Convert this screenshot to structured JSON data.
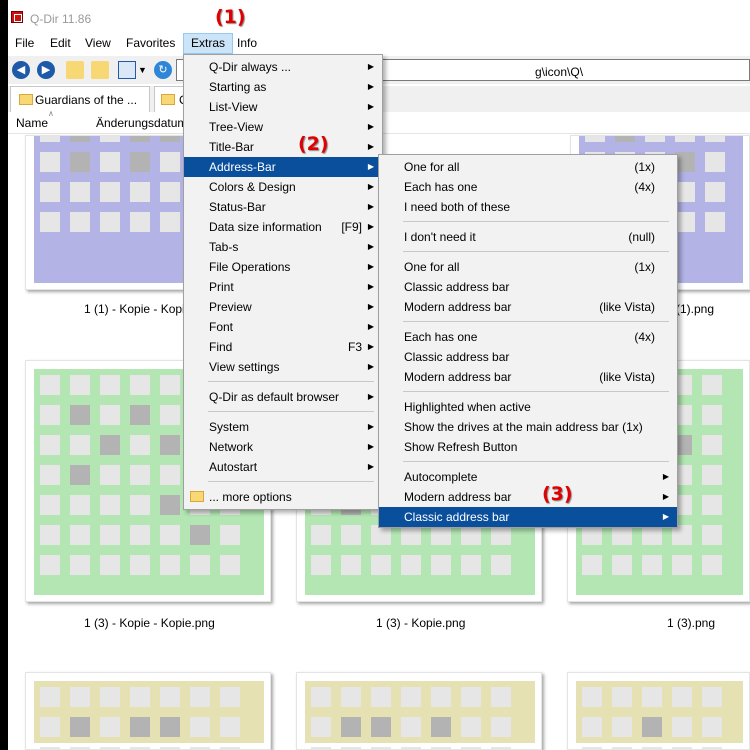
{
  "window": {
    "title": "Q-Dir 11.86"
  },
  "menubar": [
    "File",
    "Edit",
    "View",
    "Favorites",
    "Extras",
    "Info"
  ],
  "address_bar": {
    "value": "g\\icon\\Q\\"
  },
  "tabs": [
    "Guardians of the ...",
    "C"
  ],
  "columns": {
    "name": "Name",
    "date": "Änderungsdatum"
  },
  "files": {
    "row1": [
      "1 (1) - Kopie - Kopi",
      "(1).png"
    ],
    "row2": [
      "1 (3) - Kopie - Kopie.png",
      "1 (3) - Kopie.png",
      "1 (3).png"
    ]
  },
  "tile_colors": {
    "purple": "#b3b3e6",
    "green": "#b3e6b3",
    "yellow": "#e6e1b3"
  },
  "extras_menu": [
    {
      "label": "Q-Dir always ...",
      "arrow": true
    },
    {
      "label": "Starting as",
      "arrow": true
    },
    {
      "label": "List-View",
      "arrow": true
    },
    {
      "label": "Tree-View",
      "arrow": true
    },
    {
      "label": "Title-Bar",
      "arrow": true
    },
    {
      "label": "Address-Bar",
      "arrow": true,
      "selected": true
    },
    {
      "label": "Colors & Design",
      "arrow": true
    },
    {
      "label": "Status-Bar",
      "arrow": true
    },
    {
      "label": "Data size information",
      "shortcut": "[F9]",
      "arrow": true
    },
    {
      "label": "Tab-s",
      "arrow": true
    },
    {
      "label": "File Operations",
      "arrow": true
    },
    {
      "label": "Print",
      "arrow": true
    },
    {
      "label": "Preview",
      "arrow": true
    },
    {
      "label": "Font",
      "arrow": true
    },
    {
      "label": "Find",
      "shortcut": "F3",
      "arrow": true
    },
    {
      "label": "View settings",
      "arrow": true
    },
    {
      "separator": true
    },
    {
      "label": "Q-Dir as default browser",
      "arrow": true
    },
    {
      "separator": true
    },
    {
      "label": "System",
      "arrow": true
    },
    {
      "label": "Network",
      "arrow": true
    },
    {
      "label": "Autostart",
      "arrow": true
    },
    {
      "separator": true
    },
    {
      "label": "... more options",
      "icon": "folder-icon"
    }
  ],
  "address_submenu": [
    {
      "label": "One for all",
      "shortcut": "(1x)"
    },
    {
      "label": "Each has one",
      "shortcut": "(4x)"
    },
    {
      "label": "I need both of these"
    },
    {
      "separator": true
    },
    {
      "label": "I don't need it",
      "shortcut": "(null)"
    },
    {
      "separator": true
    },
    {
      "label": "One for all",
      "shortcut": "(1x)"
    },
    {
      "label": "Classic address bar"
    },
    {
      "label": "Modern address bar",
      "shortcut": "(like Vista)"
    },
    {
      "separator": true
    },
    {
      "label": "Each has one",
      "shortcut": "(4x)"
    },
    {
      "label": "Classic address bar"
    },
    {
      "label": "Modern address bar",
      "shortcut": "(like Vista)"
    },
    {
      "separator": true
    },
    {
      "label": "Highlighted when active"
    },
    {
      "label": "Show the drives at the main address bar (1x)"
    },
    {
      "label": "Show Refresh Button"
    },
    {
      "separator": true
    },
    {
      "label": "Autocomplete",
      "arrow": true
    },
    {
      "label": "Modern address bar",
      "arrow": true
    },
    {
      "label": "Classic address bar",
      "arrow": true,
      "selected": true
    }
  ],
  "annotations": [
    "(1)",
    "(2)",
    "(3)"
  ]
}
